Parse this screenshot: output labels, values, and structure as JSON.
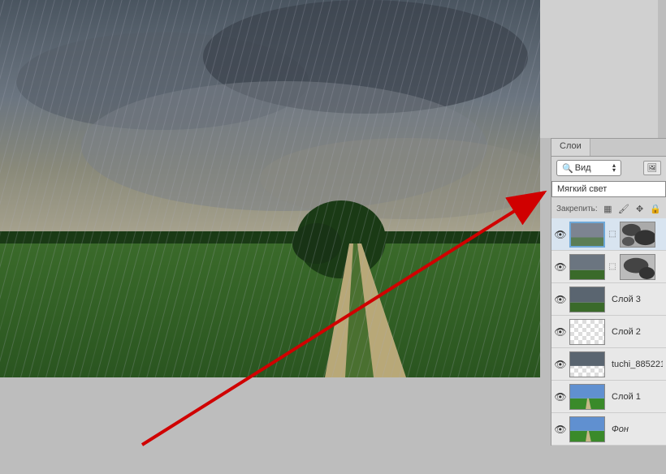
{
  "panel": {
    "tab_label": "Слои",
    "filter_label": "Вид",
    "blend_mode": "Мягкий свет",
    "lock_label": "Закрепить:"
  },
  "layers": {
    "layer3": "Слой 3",
    "layer2": "Слой 2",
    "tuchi": "tuchi_88522166...",
    "layer1": "Слой 1",
    "background": "Фон"
  }
}
